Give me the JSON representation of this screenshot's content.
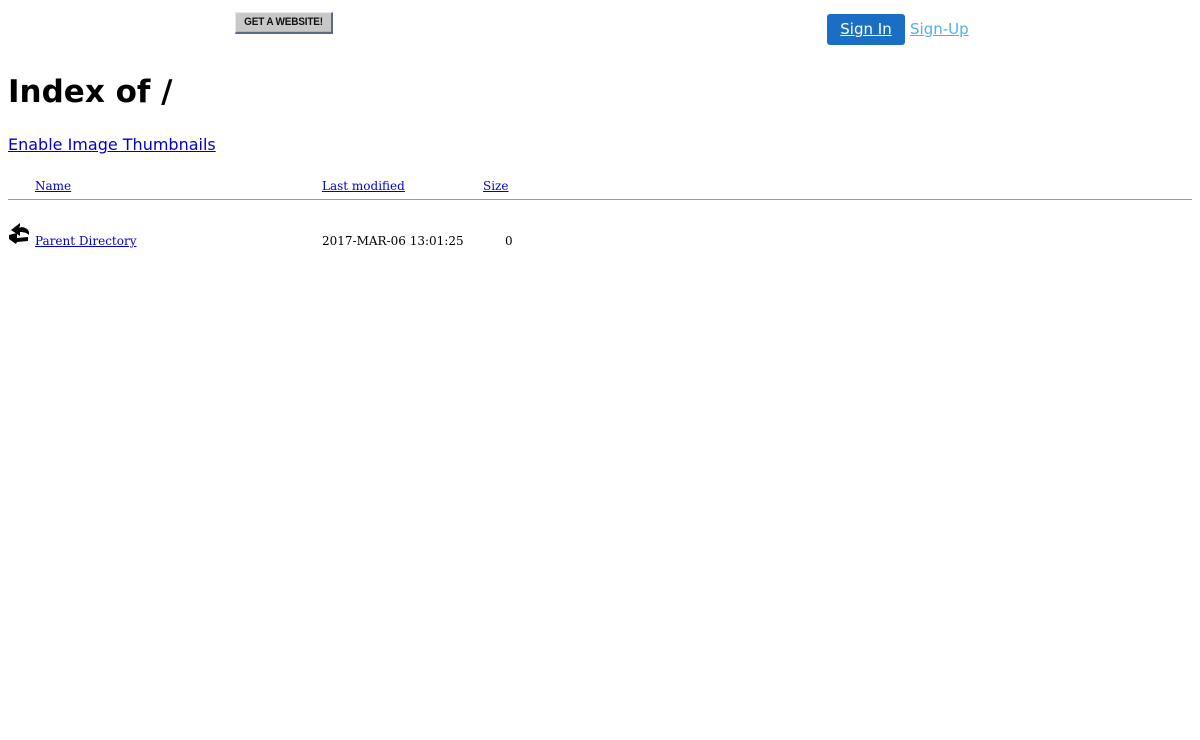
{
  "topbar": {
    "get_website_label": "GET A WEBSITE!",
    "signin_label": "Sign In",
    "signup_label": "Sign-Up"
  },
  "page": {
    "title": "Index of /",
    "thumbnails_link": "Enable Image Thumbnails"
  },
  "table": {
    "headers": {
      "name": "Name",
      "last_modified": "Last modified",
      "size": "Size"
    },
    "rows": [
      {
        "icon": "back-arrow-icon",
        "name": "Parent Directory",
        "last_modified": "2017-MAR-06 13:01:25",
        "size": "0"
      }
    ]
  },
  "colors": {
    "signin_bg": "#1a6fc4",
    "signup_text": "#4fb3e0",
    "link": "#0000cc",
    "rule": "#999999"
  }
}
